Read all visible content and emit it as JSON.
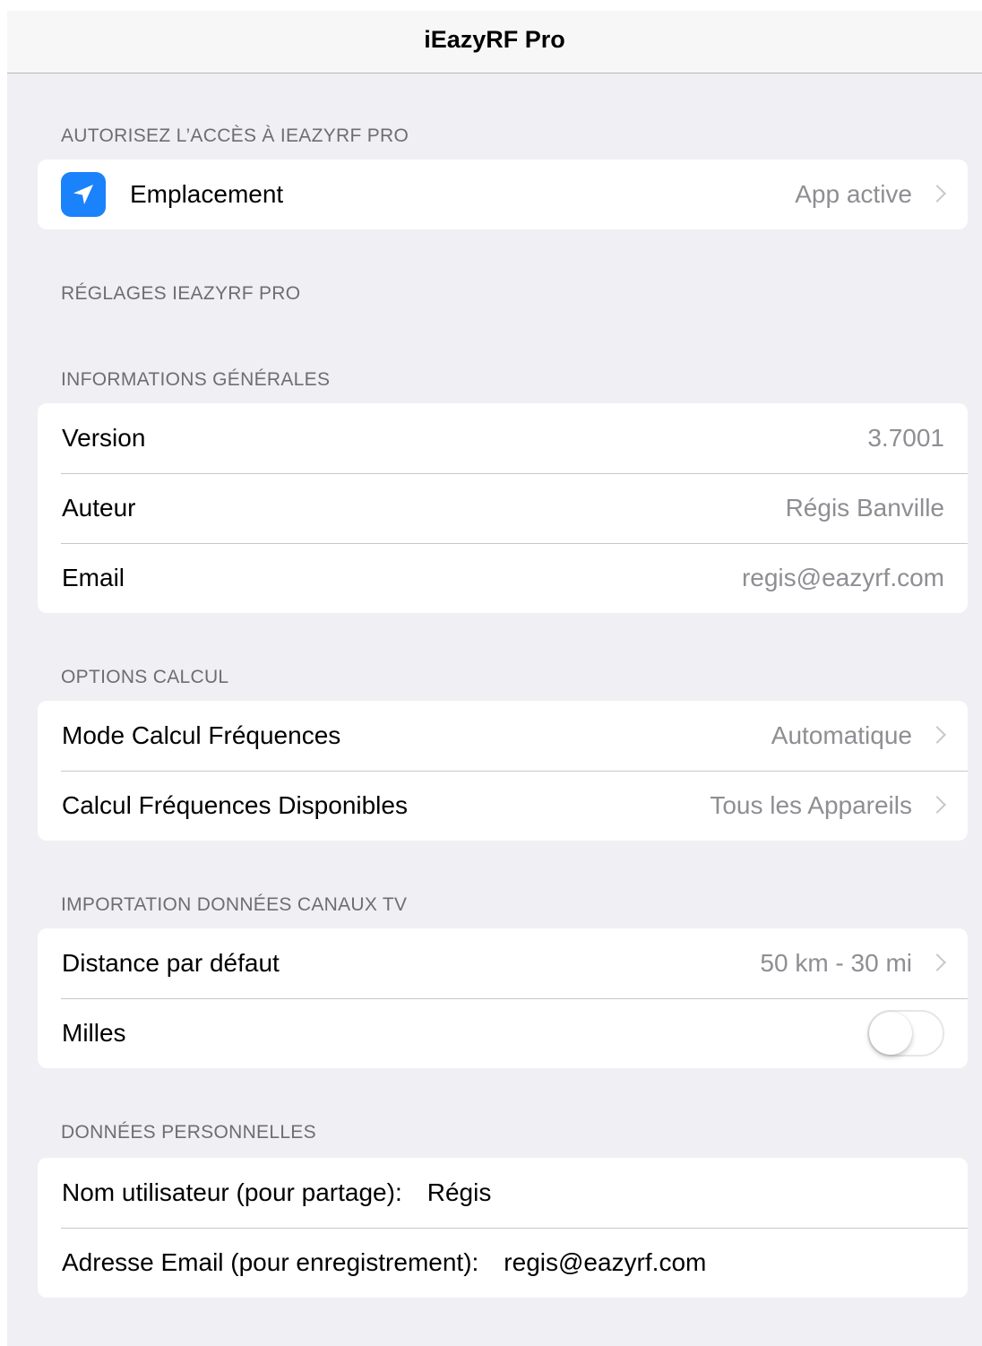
{
  "nav": {
    "title": "iEazyRF Pro"
  },
  "sections": {
    "access": {
      "header": "AUTORISEZ L’ACCÈS À IEAZYRF PRO",
      "location": {
        "icon": "location-arrow-icon",
        "label": "Emplacement",
        "value": "App active"
      }
    },
    "settings": {
      "header": "RÉGLAGES IEAZYRF PRO"
    },
    "general": {
      "header": "INFORMATIONS GÉNÉRALES",
      "rows": [
        {
          "label": "Version",
          "value": "3.7001"
        },
        {
          "label": "Auteur",
          "value": "Régis Banville"
        },
        {
          "label": "Email",
          "value": "regis@eazyrf.com"
        }
      ]
    },
    "calc": {
      "header": "OPTIONS CALCUL",
      "rows": [
        {
          "label": "Mode Calcul Fréquences",
          "value": "Automatique"
        },
        {
          "label": "Calcul Fréquences Disponibles",
          "value": "Tous les Appareils"
        }
      ]
    },
    "import": {
      "header": "IMPORTATION DONNÉES CANAUX TV",
      "distance": {
        "label": "Distance par défaut",
        "value": "50 km - 30 mi"
      },
      "miles": {
        "label": "Milles",
        "on": false
      }
    },
    "personal": {
      "header": "DONNÉES PERSONNELLES",
      "username": {
        "label": "Nom utilisateur (pour partage):",
        "value": "Régis"
      },
      "email": {
        "label": "Adresse Email (pour enregistrement):",
        "value": "regis@eazyrf.com"
      }
    }
  },
  "colors": {
    "background": "#efeff4",
    "accent": "#1a82fb",
    "secondary_text": "#8e8e93",
    "separator": "#c8c7cc"
  }
}
